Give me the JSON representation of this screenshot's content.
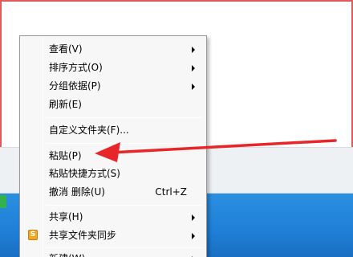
{
  "menu": {
    "items": [
      {
        "label": "查看(V)",
        "submenu": true
      },
      {
        "label": "排序方式(O)",
        "submenu": true
      },
      {
        "label": "分组依据(P)",
        "submenu": true
      },
      {
        "label": "刷新(E)",
        "submenu": false
      },
      {
        "label": "自定义文件夹(F)...",
        "submenu": false
      },
      {
        "label": "粘贴(P)",
        "submenu": false
      },
      {
        "label": "粘贴快捷方式(S)",
        "submenu": false
      },
      {
        "label": "撤消 删除(U)",
        "shortcut": "Ctrl+Z",
        "submenu": false
      },
      {
        "label": "共享(H)",
        "submenu": true
      },
      {
        "label": "共享文件夹同步",
        "submenu": true,
        "icon": "sync-folder-icon"
      },
      {
        "label": "新建(W)",
        "submenu": true
      }
    ]
  },
  "sync_icon_glyph": "S",
  "colors": {
    "annotation_arrow": "#e8262a",
    "window_border": "#e05a5a",
    "desktop": "#1f7fd6"
  }
}
